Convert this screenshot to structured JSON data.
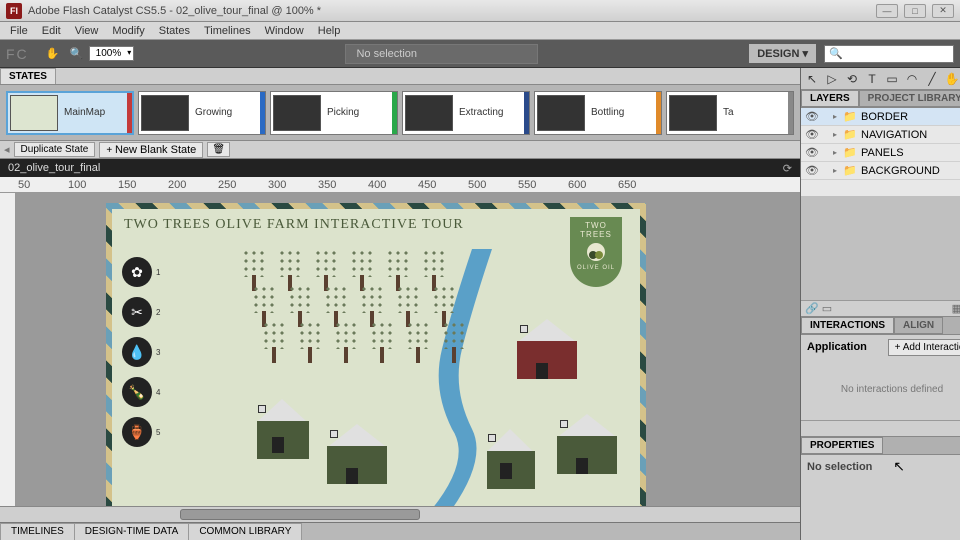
{
  "window": {
    "app_icon": "Fl",
    "title": "Adobe Flash Catalyst CS5.5 - 02_olive_tour_final @ 100% *"
  },
  "menu": {
    "file": "File",
    "edit": "Edit",
    "view": "View",
    "modify": "Modify",
    "states": "States",
    "timelines": "Timelines",
    "window": "Window",
    "help": "Help"
  },
  "toolbar": {
    "zoom": "100%",
    "no_selection": "No selection",
    "mode": "DESIGN ▾"
  },
  "states_panel": {
    "tab": "STATES",
    "items": [
      {
        "label": "MainMap",
        "color": "#c43a3a",
        "selected": true,
        "light": true
      },
      {
        "label": "Growing",
        "color": "#2a6ac4"
      },
      {
        "label": "Picking",
        "color": "#2aa84a"
      },
      {
        "label": "Extracting",
        "color": "#2a4a8a"
      },
      {
        "label": "Bottling",
        "color": "#e08a2a"
      },
      {
        "label": "Ta",
        "color": "#888"
      }
    ],
    "duplicate": "Duplicate State",
    "new_blank": "New Blank State"
  },
  "document": {
    "name": "02_olive_tour_final"
  },
  "ruler": {
    "marks": [
      "50",
      "100",
      "150",
      "200",
      "250",
      "300",
      "350",
      "400",
      "450",
      "500",
      "550",
      "600",
      "650"
    ]
  },
  "artboard": {
    "title": "TWO TREES OLIVE FARM INTERACTIVE TOUR",
    "logo": {
      "line1": "TWO",
      "line2": "TREES",
      "sub": "OLIVE OIL"
    },
    "nav": [
      {
        "icon": "✿",
        "num": "1"
      },
      {
        "icon": "✂",
        "num": "2"
      },
      {
        "icon": "💧",
        "num": "3"
      },
      {
        "icon": "🍾",
        "num": "4"
      },
      {
        "icon": "🏺",
        "num": "5"
      }
    ]
  },
  "bottom_tabs": {
    "timelines": "TIMELINES",
    "design_time": "DESIGN-TIME DATA",
    "common": "COMMON LIBRARY"
  },
  "right": {
    "tabs": {
      "layers": "LAYERS",
      "library": "PROJECT LIBRARY"
    },
    "layers": [
      {
        "name": "BORDER",
        "sel": true
      },
      {
        "name": "NAVIGATION"
      },
      {
        "name": "PANELS"
      },
      {
        "name": "BACKGROUND"
      }
    ],
    "interactions": {
      "tab1": "INTERACTIONS",
      "tab2": "ALIGN",
      "scope": "Application",
      "add": "+ Add Interaction",
      "empty": "No interactions defined"
    },
    "properties": {
      "tab": "PROPERTIES",
      "text": "No selection"
    }
  }
}
